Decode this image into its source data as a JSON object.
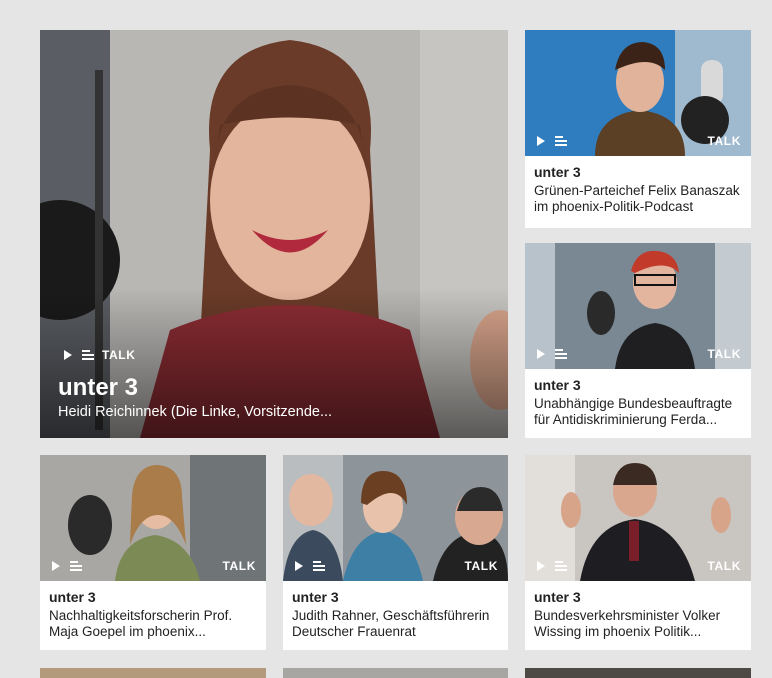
{
  "cut_text": "           ",
  "icons": {
    "play": "play-icon",
    "text": "text-lines-icon"
  },
  "tiles": {
    "hero": {
      "type_label": "TALK",
      "show": "unter 3",
      "desc": "Heidi Reichinnek (Die Linke, Vorsitzende..."
    },
    "r1": {
      "type_label": "TALK",
      "show": "unter 3",
      "desc": "Grünen-Parteichef Felix Banaszak im phoenix-Politik-Podcast"
    },
    "r2": {
      "type_label": "TALK",
      "show": "unter 3",
      "desc": "Unabhängige Bundesbeauftragte für Antidiskriminierung Ferda..."
    },
    "b1": {
      "type_label": "TALK",
      "show": "unter 3",
      "desc": "Nachhaltigkeitsforscherin Prof. Maja Goepel im phoenix..."
    },
    "b2": {
      "type_label": "TALK",
      "show": "unter 3",
      "desc": "Judith Rahner, Geschäftsführerin Deutscher Frauenrat"
    },
    "b3": {
      "type_label": "TALK",
      "show": "unter 3",
      "desc": "Bundesverkehrsminister Volker Wissing im phoenix Politik..."
    }
  }
}
